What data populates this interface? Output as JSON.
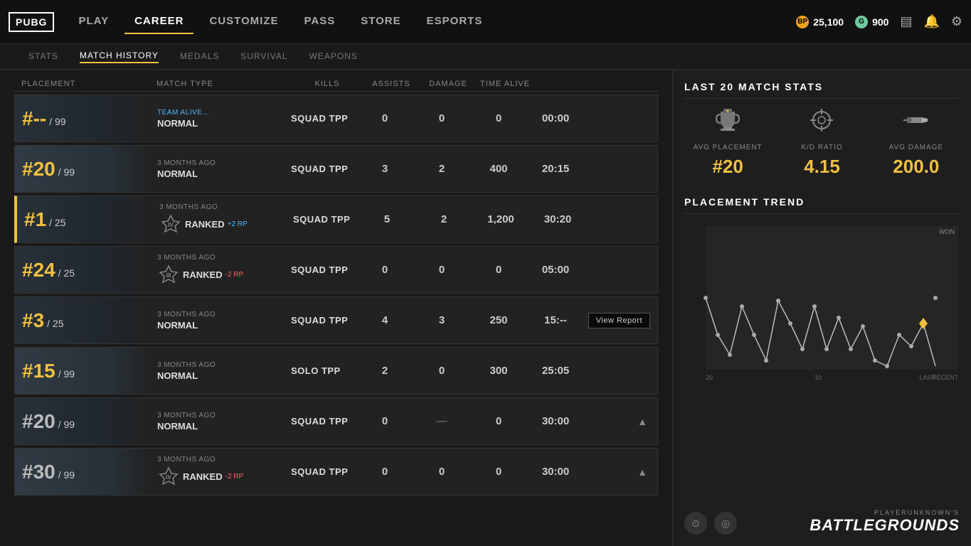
{
  "logo": "PUBG",
  "nav": {
    "items": [
      {
        "label": "PLAY",
        "active": false
      },
      {
        "label": "CAREER",
        "active": true
      },
      {
        "label": "CUSTOMIZE",
        "active": false
      },
      {
        "label": "PASS",
        "active": false
      },
      {
        "label": "STORE",
        "active": false
      },
      {
        "label": "ESPORTS",
        "active": false
      }
    ]
  },
  "sub_nav": {
    "items": [
      {
        "label": "STATS",
        "active": false
      },
      {
        "label": "MATCH HISTORY",
        "active": true
      },
      {
        "label": "MEDALS",
        "active": false
      },
      {
        "label": "SURVIVAL",
        "active": false
      },
      {
        "label": "WEAPONS",
        "active": false
      }
    ]
  },
  "currency": {
    "bp_label": "BP",
    "bp_value": "25,100",
    "g_label": "G",
    "g_value": "900"
  },
  "table": {
    "headers": [
      "PLACEMENT",
      "MATCH TYPE",
      "KILLS",
      "ASSISTS",
      "DAMAGE",
      "TIME ALIVE"
    ],
    "rows": [
      {
        "placement": "#--",
        "total": "/ 99",
        "placement_color": "yellow",
        "age": "TEAM ALIVE...",
        "age_color": "blue",
        "mode": "NORMAL",
        "rp": null,
        "match_type": "SQUAD TPP",
        "kills": "0",
        "assists": "0",
        "damage": "0",
        "time_alive": "00:00",
        "winner": false,
        "ranked": false
      },
      {
        "placement": "#20",
        "total": "/ 99",
        "placement_color": "yellow",
        "age": "3 MONTHS AGO",
        "age_color": "normal",
        "mode": "NORMAL",
        "rp": null,
        "match_type": "SQUAD TPP",
        "kills": "3",
        "assists": "2",
        "damage": "400",
        "time_alive": "20:15",
        "winner": false,
        "ranked": false
      },
      {
        "placement": "#1",
        "total": "/ 25",
        "placement_color": "yellow",
        "age": "3 MONTHS AGO",
        "age_color": "normal",
        "mode": "RANKED",
        "rp": "+2 RP",
        "rp_color": "pos",
        "match_type": "SQUAD TPP",
        "kills": "5",
        "assists": "2",
        "damage": "1,200",
        "time_alive": "30:20",
        "winner": true,
        "ranked": true
      },
      {
        "placement": "#24",
        "total": "/ 25",
        "placement_color": "yellow",
        "age": "3 MONTHS AGO",
        "age_color": "normal",
        "mode": "RANKED",
        "rp": "-2 RP",
        "rp_color": "neg",
        "match_type": "SQUAD TPP",
        "kills": "0",
        "assists": "0",
        "damage": "0",
        "time_alive": "05:00",
        "winner": false,
        "ranked": true
      },
      {
        "placement": "#3",
        "total": "/ 25",
        "placement_color": "yellow",
        "age": "3 MONTHS AGO",
        "age_color": "normal",
        "mode": "NORMAL",
        "rp": null,
        "match_type": "SQUAD TPP",
        "kills": "4",
        "assists": "3",
        "damage": "250",
        "time_alive": "15:--",
        "winner": false,
        "ranked": false,
        "show_view_report": true
      },
      {
        "placement": "#15",
        "total": "/ 99",
        "placement_color": "yellow",
        "age": "3 MONTHS AGO",
        "age_color": "normal",
        "mode": "NORMAL",
        "rp": null,
        "match_type": "SOLO TPP",
        "kills": "2",
        "assists": "0",
        "damage": "300",
        "time_alive": "25:05",
        "winner": false,
        "ranked": false
      },
      {
        "placement": "#20",
        "total": "/ 99",
        "placement_color": "white",
        "age": "3 MONTHS AGO",
        "age_color": "normal",
        "mode": "NORMAL",
        "rp": null,
        "match_type": "SQUAD TPP",
        "kills": "0",
        "assists": "—",
        "damage": "0",
        "time_alive": "30:00",
        "winner": false,
        "ranked": false,
        "warning": true
      },
      {
        "placement": "#30",
        "total": "/ 99",
        "placement_color": "white",
        "age": "3 MONTHS AGO",
        "age_color": "normal",
        "mode": "RANKED",
        "rp": "-2 RP",
        "rp_color": "neg",
        "match_type": "SQUAD TPP",
        "kills": "0",
        "assists": "0",
        "damage": "0",
        "time_alive": "30:00",
        "winner": false,
        "ranked": true,
        "warning": true
      }
    ]
  },
  "last20": {
    "title": "LAST 20 MATCH STATS",
    "stats": [
      {
        "label": "AVG PLACEMENT",
        "value": "#20",
        "icon": "trophy"
      },
      {
        "label": "K/D RATIO",
        "value": "4.15",
        "icon": "crosshair"
      },
      {
        "label": "AVG DAMAGE",
        "value": "200.0",
        "icon": "bullet"
      }
    ]
  },
  "trend": {
    "title": "PLACEMENT TREND",
    "x_label_left": "20",
    "x_label_mid": "10",
    "x_label_right": "LAST RECENT",
    "y_label_top": "WON",
    "chart_data": [
      22,
      14,
      8,
      18,
      12,
      6,
      20,
      15,
      10,
      18,
      8,
      16,
      10,
      14,
      6,
      4,
      10,
      8,
      12,
      2
    ]
  },
  "watermark": {
    "sub": "PLAYERUNKNOWN'S",
    "main": "BATTLEGROUNDS"
  },
  "view_report_label": "View Report"
}
